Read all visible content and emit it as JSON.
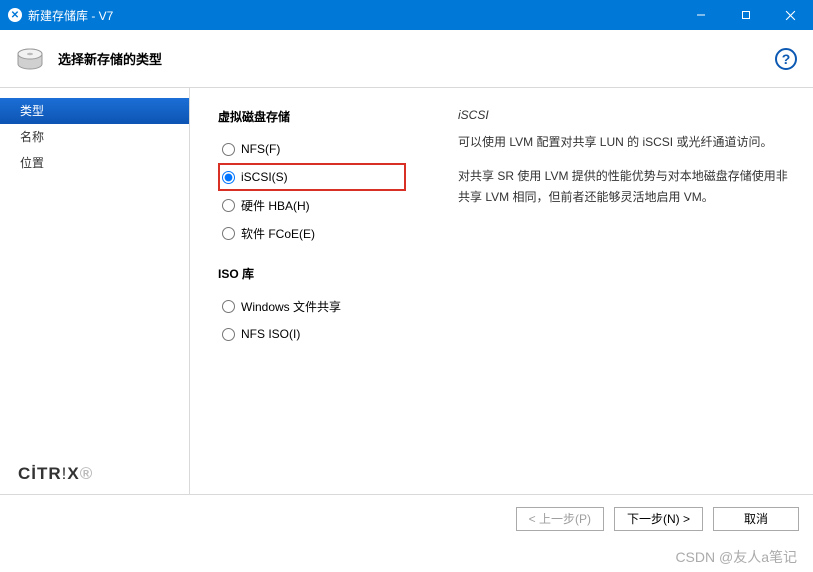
{
  "titlebar": {
    "title": "新建存储库 - V7"
  },
  "header": {
    "title": "选择新存储的类型"
  },
  "sidebar": {
    "steps": [
      {
        "label": "类型",
        "active": true
      },
      {
        "label": "名称",
        "active": false
      },
      {
        "label": "位置",
        "active": false
      }
    ],
    "logo_prefix": "CİTR",
    "logo_suffix": "X"
  },
  "content": {
    "virtual_heading": "虚拟磁盘存储",
    "iso_heading": "ISO 库",
    "options_virtual": [
      {
        "label": "NFS(F)",
        "checked": false,
        "highlighted": false
      },
      {
        "label": "iSCSI(S)",
        "checked": true,
        "highlighted": true
      },
      {
        "label": "硬件 HBA(H)",
        "checked": false,
        "highlighted": false
      },
      {
        "label": "软件 FCoE(E)",
        "checked": false,
        "highlighted": false
      }
    ],
    "options_iso": [
      {
        "label": "Windows 文件共享",
        "checked": false
      },
      {
        "label": "NFS ISO(I)",
        "checked": false
      }
    ],
    "description": {
      "title": "iSCSI",
      "para1": "可以使用 LVM 配置对共享 LUN 的 iSCSI 或光纤通道访问。",
      "para2": "对共享 SR 使用 LVM 提供的性能优势与对本地磁盘存储使用非共享 LVM 相同，但前者还能够灵活地启用 VM。"
    }
  },
  "footer": {
    "prev": "< 上一步(P)",
    "next": "下一步(N) >",
    "cancel": "取消"
  },
  "watermark": "CSDN @友人a笔记"
}
